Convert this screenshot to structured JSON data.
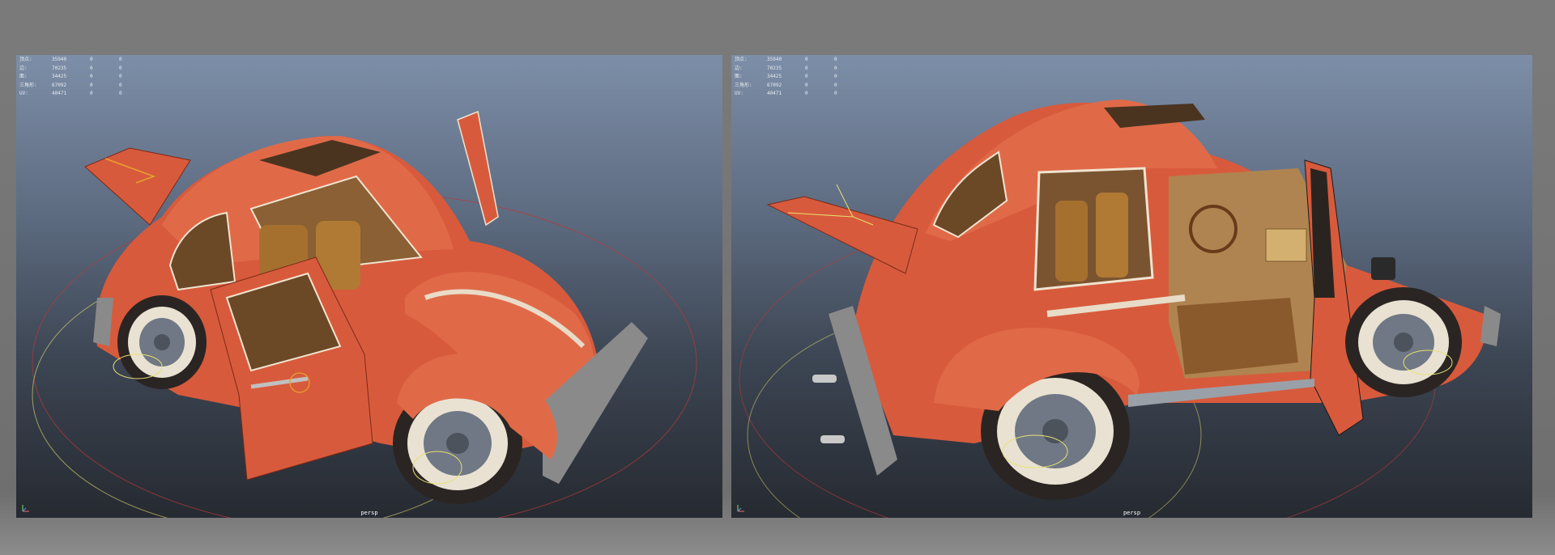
{
  "viewports": [
    {
      "camera": "persp",
      "hud": [
        {
          "label": "顶点:",
          "values": [
            "35940",
            "0",
            "0"
          ]
        },
        {
          "label": "边:",
          "values": [
            "70235",
            "0",
            "0"
          ]
        },
        {
          "label": "面:",
          "values": [
            "34425",
            "0",
            "0"
          ]
        },
        {
          "label": "三角形:",
          "values": [
            "67092",
            "0",
            "0"
          ]
        },
        {
          "label": "UV:",
          "values": [
            "40471",
            "0",
            "0"
          ]
        }
      ]
    },
    {
      "camera": "persp",
      "hud": [
        {
          "label": "顶点:",
          "values": [
            "35940",
            "0",
            "0"
          ]
        },
        {
          "label": "边:",
          "values": [
            "70235",
            "0",
            "0"
          ]
        },
        {
          "label": "面:",
          "values": [
            "34425",
            "0",
            "0"
          ]
        },
        {
          "label": "三角形:",
          "values": [
            "67092",
            "0",
            "0"
          ]
        },
        {
          "label": "UV:",
          "values": [
            "40471",
            "0",
            "0"
          ]
        }
      ]
    }
  ],
  "colors": {
    "car_body": "#d85a3c",
    "car_shadow": "#a63a24",
    "interior": "#9a6a32",
    "tire": "#2a2522",
    "whitewall": "#e9e2d2",
    "hubcap": "#6f7884",
    "bumper": "#8a8a8a",
    "wire_yellow": "#e8e070",
    "wire_red": "#b83a3a"
  },
  "icons": [
    "axis-icon"
  ]
}
